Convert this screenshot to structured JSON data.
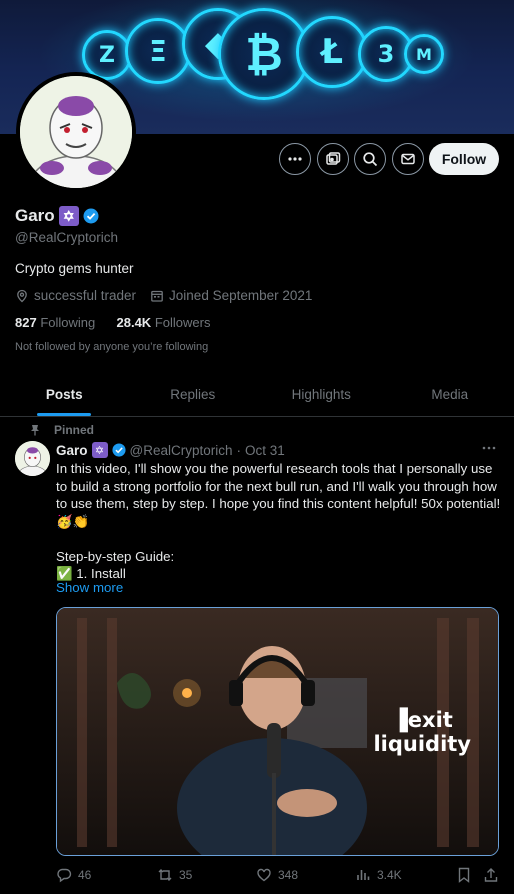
{
  "profile": {
    "name": "Garo",
    "handle": "@RealCryptorich",
    "bio": "Crypto gems hunter",
    "profession": "successful trader",
    "joined": "Joined September 2021",
    "following_count": "827",
    "following_label": "Following",
    "followers_count": "28.4K",
    "followers_label": "Followers",
    "not_followed": "Not followed by anyone you’re following"
  },
  "buttons": {
    "follow": "Follow"
  },
  "icons": [
    "more-icon",
    "subscribe-icon",
    "search-icon",
    "message-icon",
    "location-icon",
    "calendar-icon",
    "verified-icon",
    "pin-icon"
  ],
  "tabs": [
    {
      "label": "Posts",
      "active": true
    },
    {
      "label": "Replies",
      "active": false
    },
    {
      "label": "Highlights",
      "active": false
    },
    {
      "label": "Media",
      "active": false
    }
  ],
  "post": {
    "pinned_label": "Pinned",
    "author": "Garo",
    "handle": "@RealCryptorich",
    "separator": "·",
    "date": "Oct 31",
    "text": "In this video, I'll show you the powerful research tools that I personally use to build a strong portfolio for the next bull run, and I'll walk you through how to use them, step by step. I hope you find this content helpful! 50x potential! 🥳👏\n\nStep-by-step Guide:\n✅ 1. Install",
    "show_more": "Show more",
    "video_watermark_line1": "exit",
    "video_watermark_line2": "liquidity",
    "replies": "46",
    "reposts": "35",
    "likes": "348",
    "views": "3.4K"
  },
  "colors": {
    "accent": "#1d9bf0",
    "text": "#e7e9ea",
    "muted": "#71767b",
    "border": "#2f3336"
  }
}
